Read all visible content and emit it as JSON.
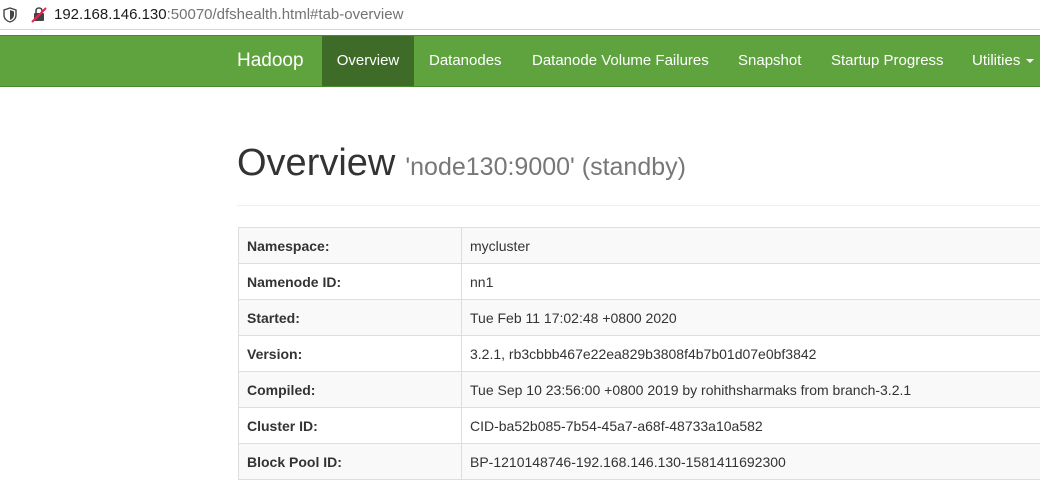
{
  "browser": {
    "url_host": "192.168.146.130",
    "url_rest": ":50070/dfshealth.html#tab-overview"
  },
  "navbar": {
    "brand": "Hadoop",
    "items": [
      {
        "label": "Overview"
      },
      {
        "label": "Datanodes"
      },
      {
        "label": "Datanode Volume Failures"
      },
      {
        "label": "Snapshot"
      },
      {
        "label": "Startup Progress"
      },
      {
        "label": "Utilities"
      }
    ],
    "active_index": 0
  },
  "header": {
    "title": "Overview",
    "subtitle": "'node130:9000' (standby)"
  },
  "info": {
    "rows": [
      {
        "key": "Namespace:",
        "value": "mycluster"
      },
      {
        "key": "Namenode ID:",
        "value": "nn1"
      },
      {
        "key": "Started:",
        "value": "Tue Feb 11 17:02:48 +0800 2020"
      },
      {
        "key": "Version:",
        "value": "3.2.1, rb3cbbb467e22ea829b3808f4b7b01d07e0bf3842"
      },
      {
        "key": "Compiled:",
        "value": "Tue Sep 10 23:56:00 +0800 2019 by rohithsharmaks from branch-3.2.1"
      },
      {
        "key": "Cluster ID:",
        "value": "CID-ba52b085-7b54-45a7-a68f-48733a10a582"
      },
      {
        "key": "Block Pool ID:",
        "value": "BP-1210148746-192.168.146.130-1581411692300"
      }
    ]
  },
  "colors": {
    "navbar": "#5fa33e",
    "navbar_active": "#3e6b28"
  }
}
